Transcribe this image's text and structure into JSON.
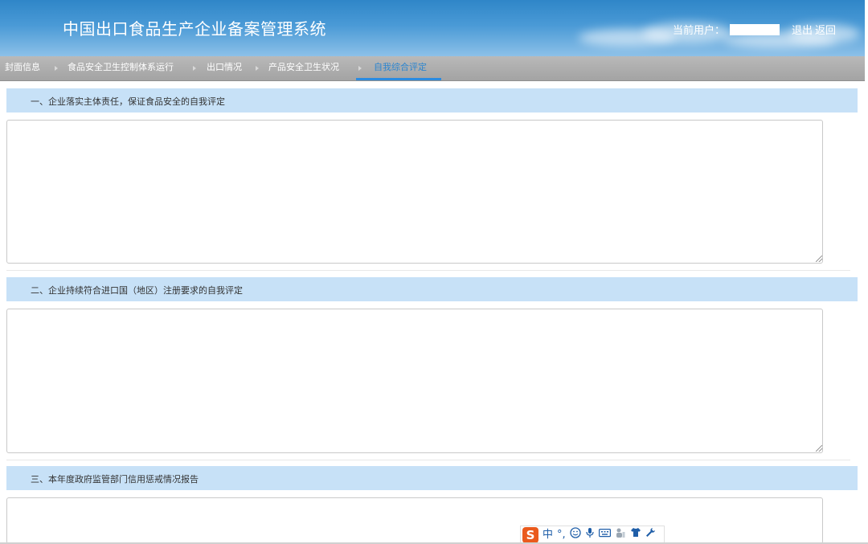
{
  "header": {
    "title": "中国出口食品生产企业备案管理系统",
    "user_label": "当前用户：",
    "logout_label": "退出",
    "back_label": "返回"
  },
  "tabs": [
    {
      "label": "封面信息",
      "active": false
    },
    {
      "label": "食品安全卫生控制体系运行",
      "active": false
    },
    {
      "label": "出口情况",
      "active": false
    },
    {
      "label": "产品安全卫生状况",
      "active": false
    },
    {
      "label": "自我综合评定",
      "active": true
    }
  ],
  "sections": [
    {
      "title": "一、企业落实主体责任，保证食品安全的自我评定",
      "value": ""
    },
    {
      "title": "二、企业持续符合进口国（地区）注册要求的自我评定",
      "value": ""
    },
    {
      "title": "三、本年度政府监管部门信用惩戒情况报告",
      "value": ""
    }
  ],
  "ime": {
    "logo": "S",
    "mode": "中",
    "punct": "°,",
    "emoji_icon": "smiley-icon",
    "voice_icon": "microphone-icon",
    "keyboard_icon": "keyboard-icon",
    "handwrite_icon": "handwriting-icon",
    "skin_icon": "shirt-icon",
    "tools_icon": "wrench-icon"
  },
  "colors": {
    "header_blue": "#2f86c8",
    "section_bar": "#c7e1f7",
    "tab_active": "#2b85d0",
    "tabbar_grey": "#a8a8a8",
    "ime_orange": "#ea5a1d"
  }
}
